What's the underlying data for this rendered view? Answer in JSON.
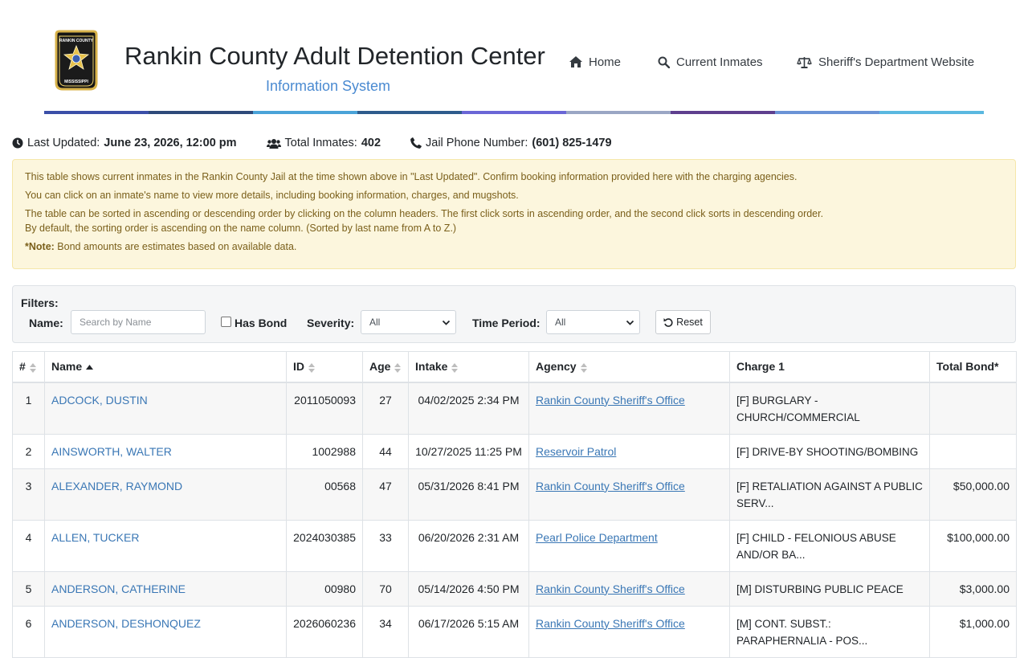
{
  "header": {
    "title": "Rankin County Adult Detention Center",
    "subtitle": "Information System",
    "logo": {
      "top_text": "RANKIN COUNTY",
      "bottom_text": "MISSISSIPPI"
    },
    "nav": [
      {
        "label": "Home",
        "icon": "home-icon"
      },
      {
        "label": "Current Inmates",
        "icon": "search-icon"
      },
      {
        "label": "Sheriff's Department Website",
        "icon": "balance-scale-icon"
      }
    ],
    "stripe_colors": [
      "#3b4fa8",
      "#2e4a7a",
      "#4aa3d8",
      "#2e5b8c",
      "#6a66d6",
      "#9aa6c4",
      "#5e3f8e",
      "#6a93d6",
      "#5ab8e0"
    ]
  },
  "info": {
    "last_updated_label": "Last Updated:",
    "last_updated_value": "June 23, 2026, 12:00 pm",
    "total_label": "Total Inmates:",
    "total_value": "402",
    "phone_label": "Jail Phone Number:",
    "phone_value": "(601) 825-1479"
  },
  "notice": {
    "line1": "This table shows current inmates in the Rankin County Jail at the time shown above in \"Last Updated\". Confirm booking information provided here with the charging agencies.",
    "line2": "You can click on an inmate's name to view more details, including booking information, charges, and mugshots.",
    "line3": "The table can be sorted in ascending or descending order by clicking on the column headers. The first click sorts in ascending order, and the second click sorts in descending order.",
    "line4": "By default, the sorting order is ascending on the name column. (Sorted by last name from A to Z.)",
    "note_label": "*Note:",
    "note_text": "Bond amounts are estimates based on available data."
  },
  "filters": {
    "heading": "Filters:",
    "name_label": "Name:",
    "name_placeholder": "Search by Name",
    "name_value": "",
    "has_bond_label": "Has Bond",
    "has_bond_checked": false,
    "severity_label": "Severity:",
    "severity_value": "All",
    "period_label": "Time Period:",
    "period_value": "All",
    "reset_label": "Reset"
  },
  "table": {
    "columns": [
      "#",
      "Name",
      "ID",
      "Age",
      "Intake",
      "Agency",
      "Charge 1",
      "Total Bond*"
    ],
    "rows": [
      {
        "num": "1",
        "name": "ADCOCK, DUSTIN",
        "id": "2011050093",
        "age": "27",
        "intake": "04/02/2025 2:34 PM",
        "agency": "Rankin County Sheriff's Office",
        "charge": "[F] BURGLARY - CHURCH/COMMERCIAL",
        "bond": ""
      },
      {
        "num": "2",
        "name": "AINSWORTH, WALTER",
        "id": "1002988",
        "age": "44",
        "intake": "10/27/2025 11:25 PM",
        "agency": "Reservoir Patrol",
        "charge": "[F] DRIVE-BY SHOOTING/BOMBING",
        "bond": ""
      },
      {
        "num": "3",
        "name": "ALEXANDER, RAYMOND",
        "id": "00568",
        "age": "47",
        "intake": "05/31/2026 8:41 PM",
        "agency": "Rankin County Sheriff's Office",
        "charge": "[F] RETALIATION AGAINST A PUBLIC SERV...",
        "bond": "$50,000.00"
      },
      {
        "num": "4",
        "name": "ALLEN, TUCKER",
        "id": "2024030385",
        "age": "33",
        "intake": "06/20/2026 2:31 AM",
        "agency": "Pearl Police Department",
        "charge": "[F] CHILD - FELONIOUS ABUSE AND/OR BA...",
        "bond": "$100,000.00"
      },
      {
        "num": "5",
        "name": "ANDERSON, CATHERINE",
        "id": "00980",
        "age": "70",
        "intake": "05/14/2026 4:50 PM",
        "agency": "Rankin County Sheriff's Office",
        "charge": "[M] DISTURBING PUBLIC PEACE",
        "bond": "$3,000.00"
      },
      {
        "num": "6",
        "name": "ANDERSON, DESHONQUEZ",
        "id": "2026060236",
        "age": "34",
        "intake": "06/17/2026 5:15 AM",
        "agency": "Rankin County Sheriff's Office",
        "charge": "[M] CONT. SUBST.: PARAPHERNALIA - POS...",
        "bond": "$1,000.00"
      }
    ]
  }
}
